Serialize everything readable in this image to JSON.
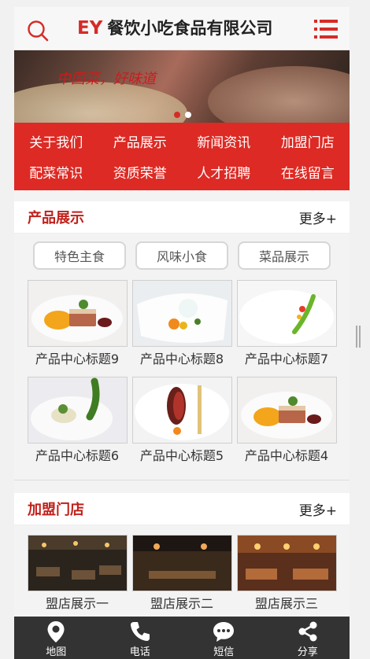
{
  "header": {
    "logo_mark": "EY",
    "logo_text": "餐饮小吃食品有限公司"
  },
  "banner": {
    "slogan": "中国菜，好味道",
    "slide_count": 2,
    "active_slide": 1
  },
  "nav": {
    "items": [
      {
        "label": "关于我们"
      },
      {
        "label": "产品展示"
      },
      {
        "label": "新闻资讯"
      },
      {
        "label": "加盟门店"
      },
      {
        "label": "配菜常识"
      },
      {
        "label": "资质荣誉"
      },
      {
        "label": "人才招聘"
      },
      {
        "label": "在线留言"
      }
    ]
  },
  "products": {
    "title": "产品展示",
    "more": "更多+",
    "tabs": [
      {
        "label": "特色主食"
      },
      {
        "label": "风味小食"
      },
      {
        "label": "菜品展示"
      }
    ],
    "items": [
      {
        "label": "产品中心标题9"
      },
      {
        "label": "产品中心标题8"
      },
      {
        "label": "产品中心标题7"
      },
      {
        "label": "产品中心标题6"
      },
      {
        "label": "产品中心标题5"
      },
      {
        "label": "产品中心标题4"
      }
    ]
  },
  "stores": {
    "title": "加盟门店",
    "more": "更多+",
    "items": [
      {
        "label": "盟店展示一"
      },
      {
        "label": "盟店展示二"
      },
      {
        "label": "盟店展示三"
      }
    ]
  },
  "bottom_bar": {
    "items": [
      {
        "label": "地图",
        "icon": "map-pin-icon"
      },
      {
        "label": "电话",
        "icon": "phone-icon"
      },
      {
        "label": "短信",
        "icon": "message-icon"
      },
      {
        "label": "分享",
        "icon": "share-icon"
      }
    ]
  },
  "colors": {
    "accent": "#dd2a24",
    "title_red": "#c0201b",
    "bottom_bar": "#333333"
  }
}
